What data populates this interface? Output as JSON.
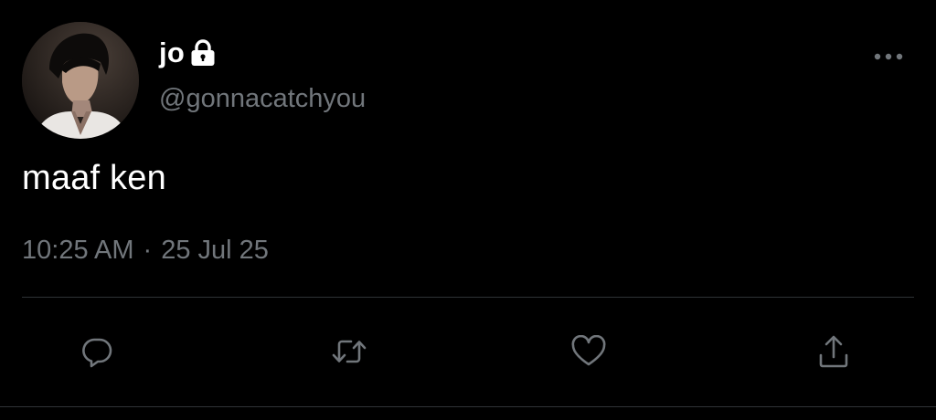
{
  "author": {
    "display_name": "jo",
    "handle": "@gonnacatchyou",
    "protected_icon": "lock-icon",
    "avatar": "profile-photo"
  },
  "tweet": {
    "text": "maaf ken",
    "time": "10:25 AM",
    "separator": "·",
    "date": "25 Jul 25"
  },
  "menu": {
    "more_icon": "more-horizontal-icon"
  },
  "actions": [
    {
      "name": "reply",
      "icon": "reply-icon"
    },
    {
      "name": "retweet",
      "icon": "retweet-icon"
    },
    {
      "name": "like",
      "icon": "heart-icon"
    },
    {
      "name": "share",
      "icon": "share-icon"
    }
  ],
  "colors": {
    "background": "#000000",
    "primary_text": "#ffffff",
    "secondary_text": "#71767b",
    "divider": "#2f3336",
    "icon": "#71767b"
  }
}
